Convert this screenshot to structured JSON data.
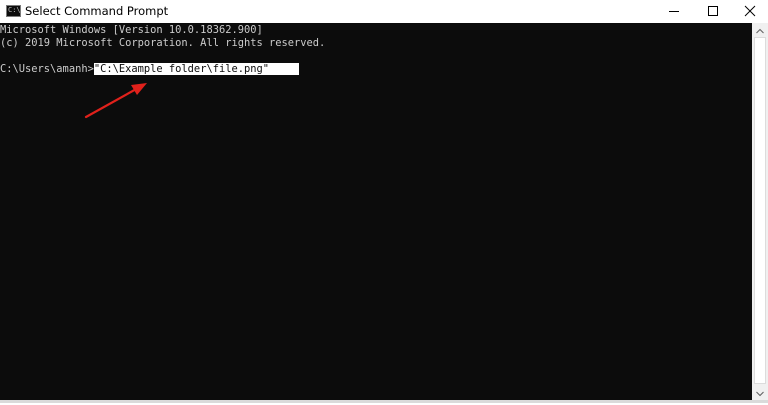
{
  "window": {
    "title": "Select Command Prompt",
    "icon": "cmd-icon",
    "icon_glyph": "C:\\",
    "controls": [
      "minimize-icon",
      "maximize-icon",
      "close-icon"
    ]
  },
  "console": {
    "lines": [
      "Microsoft Windows [Version 10.0.18362.900]",
      "(c) 2019 Microsoft Corporation. All rights reserved."
    ],
    "prompt": "C:\\Users\\amanh>",
    "selected_text": "\"C:\\Example folder\\file.png\"",
    "background_color": "#0c0c0c",
    "text_color": "#cccccc",
    "selection_color": "#ffffff"
  },
  "annotation": {
    "type": "arrow",
    "color": "#e0211b"
  }
}
